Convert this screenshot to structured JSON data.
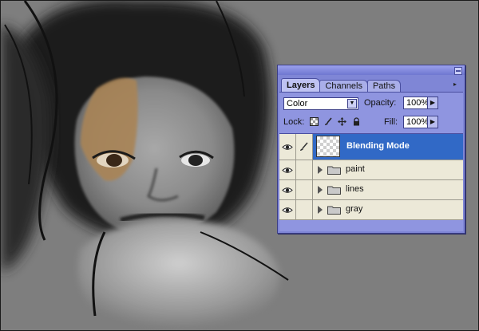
{
  "palette": {
    "tabs": [
      {
        "label": "Layers",
        "active": true
      },
      {
        "label": "Channels",
        "active": false
      },
      {
        "label": "Paths",
        "active": false
      }
    ],
    "blend_mode": "Color",
    "opacity_label": "Opacity:",
    "opacity_value": "100%",
    "lock_label": "Lock:",
    "fill_label": "Fill:",
    "fill_value": "100%",
    "lock_icons": [
      "lock-transparent-icon",
      "lock-image-brush-icon",
      "lock-position-move-icon",
      "lock-all-padlock-icon"
    ],
    "layers": [
      {
        "name": "Blending Mode",
        "type": "layer",
        "selected": true,
        "visible": true,
        "icon": "brush-icon"
      },
      {
        "name": "paint",
        "type": "group",
        "selected": false,
        "visible": true
      },
      {
        "name": "lines",
        "type": "group",
        "selected": false,
        "visible": true
      },
      {
        "name": "gray",
        "type": "group",
        "selected": false,
        "visible": true
      }
    ]
  },
  "colors": {
    "canvas_gray": "#7e7e7e",
    "palette_bg": "#7f86d6",
    "selected_layer": "#3169c6",
    "row_bg": "#ece9d8"
  }
}
